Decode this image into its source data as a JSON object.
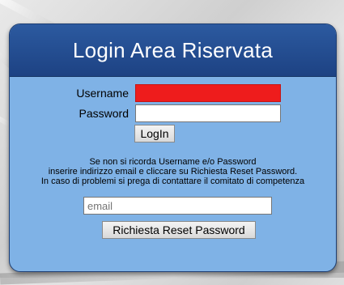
{
  "header": {
    "title": "Login Area Riservata"
  },
  "login": {
    "username_label": "Username",
    "password_label": "Password",
    "username_value": "",
    "password_value": "",
    "login_button": "LogIn"
  },
  "reset": {
    "info_lines": [
      "Se non si ricorda Username e/o Password",
      "inserire indirizzo email e cliccare su Richiesta Reset Password.",
      "In caso di problemi si prega di contattare il comitato di competenza"
    ],
    "email_placeholder": "email",
    "reset_button": "Richiesta Reset Password"
  },
  "colors": {
    "panel_bg": "#7fb2e6",
    "header_bg": "#1d4283",
    "username_highlight": "#ee1c1c"
  }
}
